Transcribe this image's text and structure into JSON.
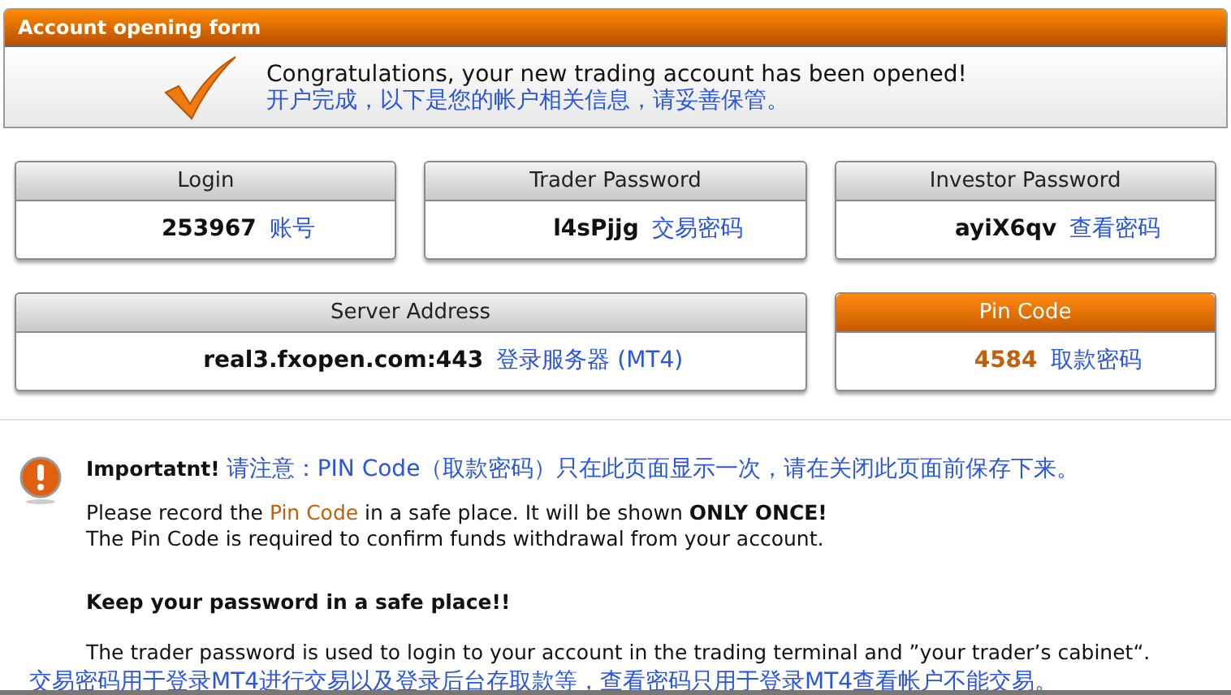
{
  "window": {
    "title": "Account opening form"
  },
  "banner": {
    "message": "Congratulations, your new trading account has been opened!",
    "message_cn": "开户完成，以下是您的帐户相关信息，请妥善保管。"
  },
  "cards": [
    {
      "kind": "normal",
      "label": "Login",
      "value": "253967",
      "note": "账号"
    },
    {
      "kind": "normal",
      "label": "Trader Password",
      "value": "l4sPjjg",
      "note": "交易密码"
    },
    {
      "kind": "normal",
      "label": "Investor Password",
      "value": "ayiX6qv",
      "note": "查看密码"
    },
    {
      "kind": "normal",
      "label": "Server Address",
      "value": "real3.fxopen.com:443",
      "note": "登录服务器 (MT4)"
    },
    {
      "kind": "highlight",
      "label": "Pin Code",
      "value": "4584",
      "note": "取款密码"
    }
  ],
  "notice": {
    "heading": "Importatnt!",
    "heading_cn": "请注意：PIN Code（取款密码）只在此页面显示一次，请在关闭此页面前保存下来。",
    "line_before": "Please record the ",
    "line_highlight": "Pin Code",
    "line_after": " in a safe place. It will be shown **ONLY ONCE!**",
    "line2": "The Pin Code is required to confirm funds withdrawal from your account.",
    "password_heading": "Keep your password in a safe place!!",
    "password_text": "The trader password is used to login to your account in the trading terminal and ”your trader’s cabinet“.",
    "password_text_cn": "交易密码用于登录MT4进行交易以及登录后台存取款等，查看密码只用于登录MT4查看帐户不能交易。"
  }
}
